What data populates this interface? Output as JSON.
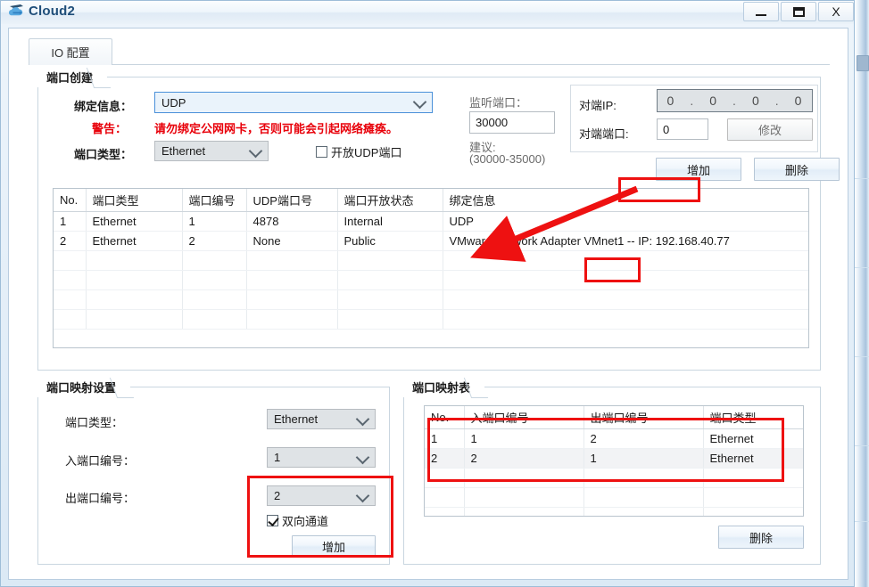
{
  "window": {
    "title": "Cloud2",
    "icon": "cloud-icon",
    "controls": {
      "minimize": "minimize-icon",
      "maximize": "maximize-icon",
      "close": "X"
    }
  },
  "tabs": [
    {
      "label": "IO 配置",
      "active": true
    }
  ],
  "port_create": {
    "group_title": "端口创建",
    "bind_info_label": "绑定信息：",
    "bind_info_value": "UDP",
    "warning_label": "警告：",
    "warning_text": "请勿绑定公网网卡，否则可能会引起网络瘫痪。",
    "port_type_label": "端口类型：",
    "port_type_value": "Ethernet",
    "open_udp_label": "开放UDP端口",
    "open_udp_checked": false,
    "listen_port_label": "监听端口：",
    "listen_port_value": "30000",
    "suggest_label": "建议:",
    "suggest_range": "(30000-35000)",
    "peer_ip_label": "对端IP:",
    "peer_ip_octets": [
      "0",
      "0",
      "0",
      "0"
    ],
    "peer_port_label": "对端端口:",
    "peer_port_value": "0",
    "modify_button": "修改",
    "add_button": "增加",
    "delete_button": "删除"
  },
  "port_table": {
    "columns": [
      "No.",
      "端口类型",
      "端口编号",
      "UDP端口号",
      "端口开放状态",
      "绑定信息"
    ],
    "rows": [
      [
        "1",
        "Ethernet",
        "1",
        "4878",
        "Internal",
        "UDP"
      ],
      [
        "2",
        "Ethernet",
        "2",
        "None",
        "Public",
        "VMware Network Adapter VMnet1 -- IP: 192.168.40.77"
      ]
    ]
  },
  "map_settings": {
    "group_title": "端口映射设置",
    "port_type_label": "端口类型：",
    "port_type_value": "Ethernet",
    "in_port_label": "入端口编号：",
    "in_port_value": "1",
    "out_port_label": "出端口编号：",
    "out_port_value": "2",
    "bidirectional_label": "双向通道",
    "bidirectional_checked": true,
    "add_button": "增加"
  },
  "map_table": {
    "group_title": "端口映射表",
    "columns": [
      "No.",
      "入端口编号",
      "出端口编号",
      "端口类型"
    ],
    "rows": [
      [
        "1",
        "1",
        "2",
        "Ethernet"
      ],
      [
        "2",
        "2",
        "1",
        "Ethernet"
      ]
    ],
    "delete_button": "删除"
  },
  "annotations": {
    "color": "#ee1111",
    "highlight_add_button": "增加",
    "highlight_vmnet": "VMnet1",
    "highlight_out_port_block": "出端口编号 / 双向通道 / 增加",
    "highlight_map_rows": "端口映射表 行 1-2",
    "arrow_from": "增加 button",
    "arrow_to": "绑定信息 列 第2行"
  }
}
